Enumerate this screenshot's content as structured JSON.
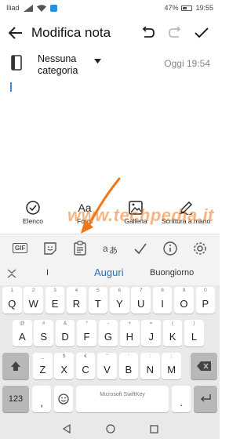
{
  "status_bar": {
    "carrier": "Iliad",
    "battery": "47%",
    "time": "19:55"
  },
  "app_bar": {
    "title": "Modifica nota",
    "back_icon": "arrow-left-icon",
    "undo_icon": "undo-icon",
    "redo_icon": "redo-icon",
    "confirm_icon": "checkmark-icon"
  },
  "note": {
    "category_line1": "Nessuna",
    "category_line2": "categoria",
    "date": "Oggi 19:54"
  },
  "tools": [
    {
      "label": "Elenco",
      "icon": "checklist-icon"
    },
    {
      "label": "Form",
      "glyph": "Aa",
      "icon": "text-format-icon"
    },
    {
      "label": "Galleria",
      "icon": "gallery-icon"
    },
    {
      "label": "Scrittura a mano",
      "icon": "pen-icon"
    }
  ],
  "watermark": "www.techpedia.it",
  "keyboard_toolbar": [
    "GIF",
    "sticker-icon",
    "clipboard-icon",
    "translate-icon",
    "checkmark-pen-icon",
    "info-icon",
    "settings-icon"
  ],
  "suggestions": {
    "left": "I",
    "center": "Auguri",
    "right": "Buongiorno"
  },
  "keyboard": {
    "row1": [
      {
        "ch": "Q",
        "hint": "1"
      },
      {
        "ch": "W",
        "hint": "2"
      },
      {
        "ch": "E",
        "hint": "3"
      },
      {
        "ch": "R",
        "hint": "4"
      },
      {
        "ch": "T",
        "hint": "5"
      },
      {
        "ch": "Y",
        "hint": "6"
      },
      {
        "ch": "U",
        "hint": "7"
      },
      {
        "ch": "I",
        "hint": "8"
      },
      {
        "ch": "O",
        "hint": "9"
      },
      {
        "ch": "P",
        "hint": "0"
      }
    ],
    "row2": [
      {
        "ch": "A",
        "hint": "@"
      },
      {
        "ch": "S",
        "hint": "#"
      },
      {
        "ch": "D",
        "hint": "&"
      },
      {
        "ch": "F",
        "hint": "*"
      },
      {
        "ch": "G",
        "hint": "-"
      },
      {
        "ch": "H",
        "hint": "+"
      },
      {
        "ch": "J",
        "hint": "="
      },
      {
        "ch": "K",
        "hint": "("
      },
      {
        "ch": "L",
        "hint": ")"
      }
    ],
    "row3": [
      {
        "ch": "Z",
        "hint": "_"
      },
      {
        "ch": "X",
        "hint": "$"
      },
      {
        "ch": "C",
        "hint": "€"
      },
      {
        "ch": "V",
        "hint": "\""
      },
      {
        "ch": "B",
        "hint": "'"
      },
      {
        "ch": "N",
        "hint": ":"
      },
      {
        "ch": "M",
        "hint": ";"
      }
    ],
    "row4": {
      "symbols": "123",
      "comma": ",",
      "space": "Microsoft SwiftKey",
      "period": "."
    }
  },
  "colors": {
    "accent_blue": "#2f6fb5",
    "watermark_orange": "#ee781e",
    "keyboard_bg": "#e9e9e9"
  }
}
